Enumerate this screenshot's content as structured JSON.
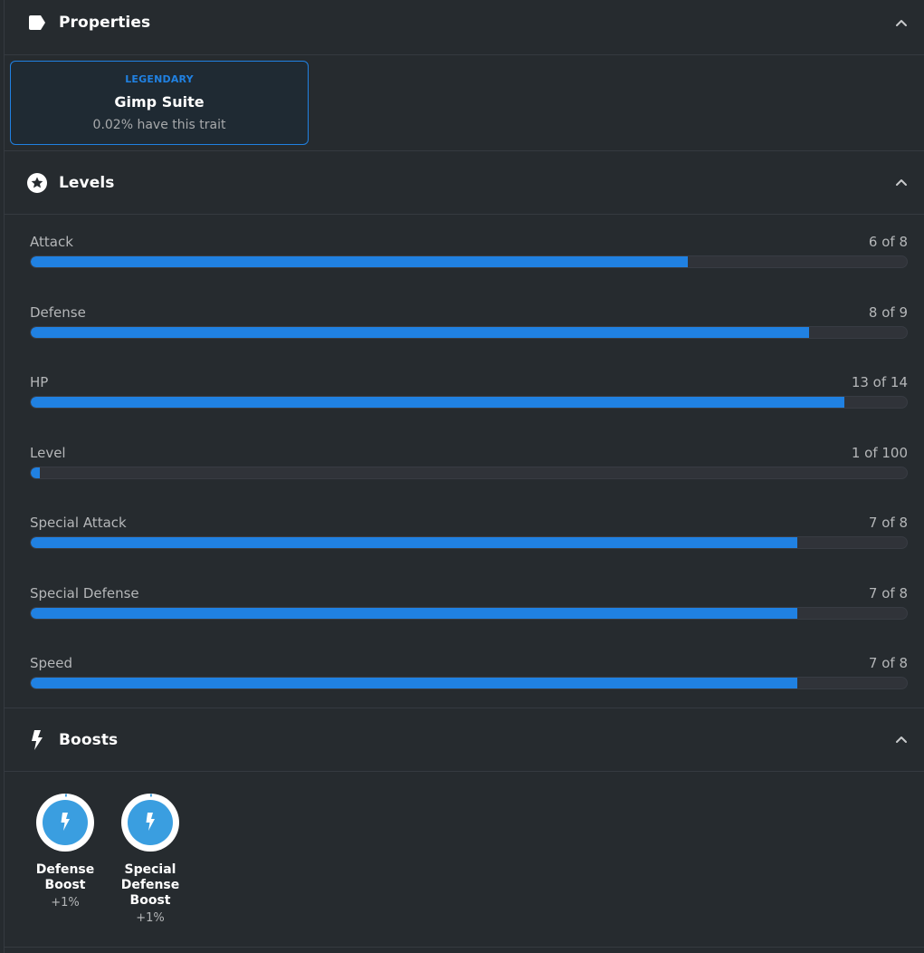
{
  "colors": {
    "accent": "#2081e2",
    "boost": "#3a9ee0",
    "background": "#262b2f",
    "muted_text": "#b5b7b9"
  },
  "properties": {
    "title": "Properties",
    "icon": "tag-icon",
    "trait": {
      "type": "LEGENDARY",
      "value": "Gimp Suite",
      "rarity": "0.02% have this trait"
    }
  },
  "levels": {
    "title": "Levels",
    "icon": "star-circle-icon",
    "items": [
      {
        "label": "Attack",
        "value_text": "6 of 8",
        "value": 6,
        "max": 8
      },
      {
        "label": "Defense",
        "value_text": "8 of 9",
        "value": 8,
        "max": 9
      },
      {
        "label": "HP",
        "value_text": "13 of 14",
        "value": 13,
        "max": 14
      },
      {
        "label": "Level",
        "value_text": "1 of 100",
        "value": 1,
        "max": 100
      },
      {
        "label": "Special Attack",
        "value_text": "7 of 8",
        "value": 7,
        "max": 8
      },
      {
        "label": "Special Defense",
        "value_text": "7 of 8",
        "value": 7,
        "max": 8
      },
      {
        "label": "Speed",
        "value_text": "7 of 8",
        "value": 7,
        "max": 8
      }
    ]
  },
  "boosts": {
    "title": "Boosts",
    "icon": "lightning-icon",
    "items": [
      {
        "name": "Defense Boost",
        "value": "+1%",
        "percent": 1
      },
      {
        "name": "Special Defense Boost",
        "value": "+1%",
        "percent": 1
      }
    ]
  }
}
